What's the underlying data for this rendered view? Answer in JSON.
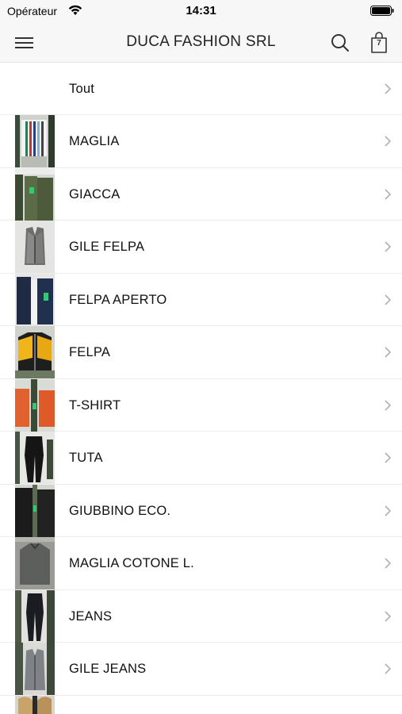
{
  "status_bar": {
    "carrier": "Opérateur",
    "time": "14:31"
  },
  "nav": {
    "title": "DUCA FASHION SRL",
    "cart_count": "7",
    "menu_icon": "hamburger-menu-icon",
    "search_icon": "search-icon",
    "cart_icon": "shopping-bag-icon"
  },
  "categories": [
    {
      "label": "Tout",
      "thumb": ""
    },
    {
      "label": "MAGLIA",
      "thumb": "striped-sweater"
    },
    {
      "label": "GIACCA",
      "thumb": "olive-jacket"
    },
    {
      "label": "GILE FELPA",
      "thumb": "grey-vest"
    },
    {
      "label": "FELPA APERTO",
      "thumb": "navy-cardigan"
    },
    {
      "label": "FELPA",
      "thumb": "yellow-black-sweatshirt"
    },
    {
      "label": "T-SHIRT",
      "thumb": "orange-tshirt"
    },
    {
      "label": "TUTA",
      "thumb": "black-tracksuit"
    },
    {
      "label": "GIUBBINO ECO.",
      "thumb": "black-leather-jacket"
    },
    {
      "label": "MAGLIA COTONE L.",
      "thumb": "grey-sweater"
    },
    {
      "label": "JEANS",
      "thumb": "black-jeans"
    },
    {
      "label": "GILE JEANS",
      "thumb": "grey-jeans-vest"
    },
    {
      "label": "",
      "thumb": "fur-collar-jacket"
    }
  ]
}
